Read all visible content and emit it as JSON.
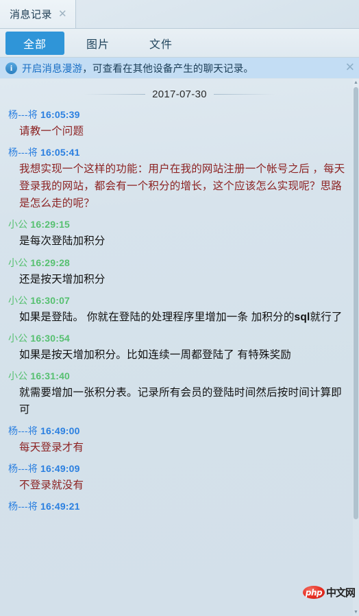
{
  "window": {
    "tab": {
      "label": "消息记录",
      "close_icon": "✕"
    }
  },
  "filters": [
    {
      "label": "全部",
      "active": true
    },
    {
      "label": "图片",
      "active": false
    },
    {
      "label": "文件",
      "active": false
    }
  ],
  "notice": {
    "icon": "i",
    "link_text": "开启消息漫游",
    "rest_text": "，可查看在其他设备产生的聊天记录。",
    "close_icon": "✕"
  },
  "conversation": {
    "date": "2017-07-30",
    "senders": {
      "a": {
        "name": "杨---将",
        "name_color": "#2a7fe0",
        "text_color": "#8c2222"
      },
      "b": {
        "name": "小公",
        "name_color": "#56c070",
        "text_color": "#111111"
      }
    },
    "messages": [
      {
        "sender": "a",
        "name": "杨---将",
        "time": "16:05:39",
        "text": "请教一个问题"
      },
      {
        "sender": "a",
        "name": "杨---将",
        "time": "16:05:41",
        "text": "我想实现一个这样的功能：用户在我的网站注册一个帐号之后 ，每天登录我的网站，都会有一个积分的增长，这个应该怎么实现呢？思路是怎么走的呢？"
      },
      {
        "sender": "b",
        "name": "小公",
        "time": "16:29:15",
        "text": "是每次登陆加积分"
      },
      {
        "sender": "b",
        "name": "小公",
        "time": "16:29:28",
        "text": "还是按天增加积分"
      },
      {
        "sender": "b",
        "name": "小公",
        "time": "16:30:07",
        "text": "如果是登陆。 你就在登陆的处理程序里增加一条 加积分的sql就行了"
      },
      {
        "sender": "b",
        "name": "小公",
        "time": "16:30:54",
        "text": "如果是按天增加积分。比如连续一周都登陆了 有特殊奖励"
      },
      {
        "sender": "b",
        "name": "小公",
        "time": "16:31:40",
        "text": "就需要增加一张积分表。记录所有会员的登陆时间然后按时间计算即可"
      },
      {
        "sender": "a",
        "name": "杨---将",
        "time": "16:49:00",
        "text": "每天登录才有"
      },
      {
        "sender": "a",
        "name": "杨---将",
        "time": "16:49:09",
        "text": "不登录就没有"
      },
      {
        "sender": "a",
        "name": "杨---将",
        "time": "16:49:21",
        "text": ""
      }
    ]
  },
  "watermark": {
    "logo_text": "php",
    "site_text": "中文网"
  },
  "scrollbar": {
    "up_arrow": "▲",
    "down_arrow": "▼"
  },
  "colors": {
    "accent": "#2f95d8",
    "notice_bg": "#c3ddf4",
    "chat_bg": "#d6e2eb"
  }
}
